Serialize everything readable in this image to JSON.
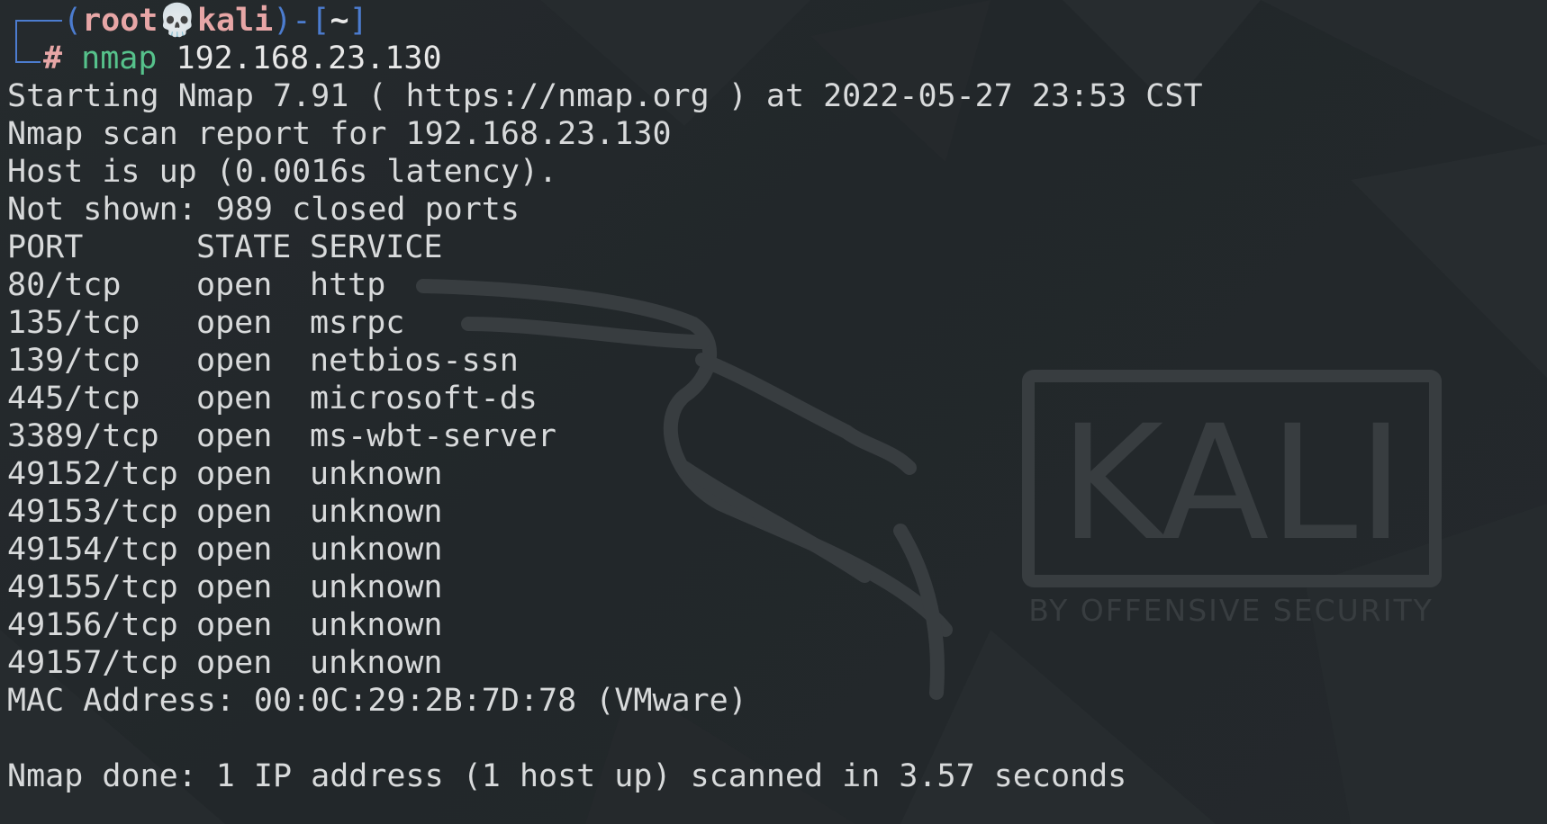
{
  "prompt": {
    "open_paren": "(",
    "user": "root",
    "skull": "💀",
    "host": "kali",
    "close_paren": ")",
    "dash": "-[",
    "path": "~",
    "close_bracket": "]",
    "hash": "#",
    "command": "nmap",
    "argument": "192.168.23.130"
  },
  "output": {
    "starting": "Starting Nmap 7.91 ( https://nmap.org ) at 2022-05-27 23:53 CST",
    "report_for": "Nmap scan report for 192.168.23.130",
    "host_up": "Host is up (0.0016s latency).",
    "not_shown": "Not shown: 989 closed ports",
    "header": {
      "port": "PORT",
      "state": "STATE",
      "service": "SERVICE"
    },
    "ports": [
      {
        "port": "80/tcp",
        "state": "open",
        "service": "http"
      },
      {
        "port": "135/tcp",
        "state": "open",
        "service": "msrpc"
      },
      {
        "port": "139/tcp",
        "state": "open",
        "service": "netbios-ssn"
      },
      {
        "port": "445/tcp",
        "state": "open",
        "service": "microsoft-ds"
      },
      {
        "port": "3389/tcp",
        "state": "open",
        "service": "ms-wbt-server"
      },
      {
        "port": "49152/tcp",
        "state": "open",
        "service": "unknown"
      },
      {
        "port": "49153/tcp",
        "state": "open",
        "service": "unknown"
      },
      {
        "port": "49154/tcp",
        "state": "open",
        "service": "unknown"
      },
      {
        "port": "49155/tcp",
        "state": "open",
        "service": "unknown"
      },
      {
        "port": "49156/tcp",
        "state": "open",
        "service": "unknown"
      },
      {
        "port": "49157/tcp",
        "state": "open",
        "service": "unknown"
      }
    ],
    "mac": "MAC Address: 00:0C:29:2B:7D:78 (VMware)",
    "done": "Nmap done: 1 IP address (1 host up) scanned in 3.57 seconds"
  },
  "wallpaper": {
    "logo_text": "KALI",
    "tagline": "BY OFFENSIVE SECURITY"
  },
  "colors": {
    "background": "#23282b",
    "text": "#d8dadb",
    "prompt_blue": "#4c7ccf",
    "prompt_red": "#e7a6a6",
    "command_green": "#56c28b",
    "watermark": "#3a3f42"
  }
}
